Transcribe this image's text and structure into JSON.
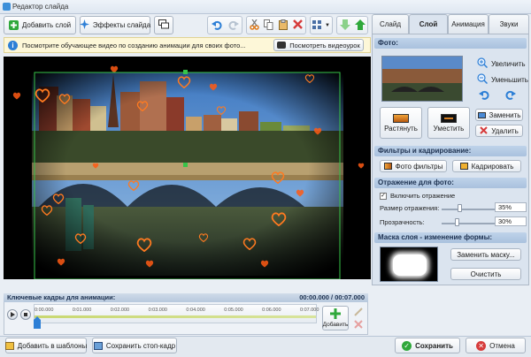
{
  "window": {
    "title": "Редактор слайда"
  },
  "toolbar": {
    "add_layer_label": "Добавить слой",
    "layer_effects_label": "Эффекты слайда"
  },
  "info": {
    "text": "Посмотрите обучающее видео по созданию анимации для своих фото...",
    "watch_button": "Посмотреть видеоурок"
  },
  "tabs": [
    "Слайд",
    "Слой",
    "Анимация",
    "Звуки"
  ],
  "active_tab": "Слой",
  "photo_section": {
    "title": "Фото:",
    "zoom_in": "Увеличить",
    "zoom_out": "Уменьшить",
    "stretch": "Растянуть",
    "fit": "Уместить",
    "replace": "Заменить",
    "delete": "Удалить"
  },
  "filters_section": {
    "title": "Фильтры и кадрирование:",
    "filters_button": "Фото фильтры",
    "crop_button": "Кадрировать"
  },
  "reflection_section": {
    "title": "Отражение для фото:",
    "enable_label": "Включить отражение",
    "enabled": true,
    "size_label": "Размер отражения:",
    "size_value": "35%",
    "size_level": 0.35,
    "opacity_label": "Прозрачность:",
    "opacity_value": "30%",
    "opacity_level": 0.3
  },
  "mask_section": {
    "title": "Маска слоя - изменение формы:",
    "replace_mask_button": "Заменить маску...",
    "clear_button": "Очистить"
  },
  "timeline": {
    "title": "Ключевые кадры для анимации:",
    "time_display": "00:00.000 / 00:07.000",
    "ticks": [
      "0:00.000",
      "0:01.000",
      "0:02.000",
      "0:03.000",
      "0:04.000",
      "0:05.000",
      "0:06.000",
      "0:07.000"
    ],
    "add_label": "Добавить"
  },
  "bottom": {
    "add_to_templates": "Добавить в шаблоны",
    "save_frame": "Сохранить стоп-кадр",
    "save": "Сохранить",
    "cancel": "Отмена"
  },
  "colors": {
    "accent": "#3c8fd9",
    "save_green": "#2fa83b",
    "cancel_red": "#d63b3b",
    "selection_green": "#37c449",
    "heart": "#ff6a1a"
  }
}
